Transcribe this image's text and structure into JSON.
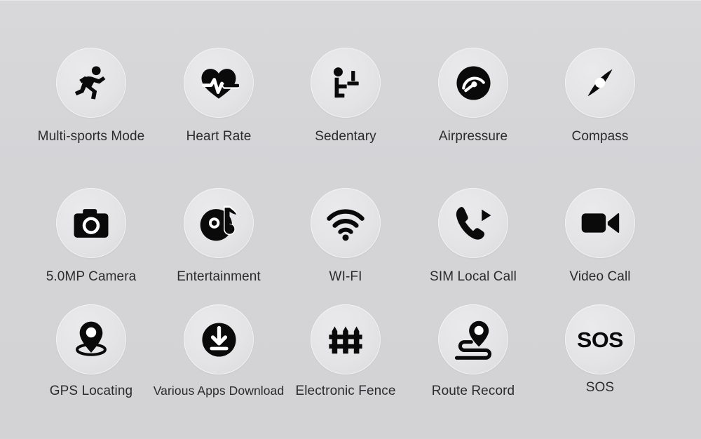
{
  "page": {
    "background_color": "#d4d4d7",
    "badge_color": "#e4e4e6",
    "icon_color": "#0a0a0a",
    "label_color": "#2b2b2d",
    "columns": 5,
    "rows": 3
  },
  "features": [
    {
      "id": "multi-sports-mode",
      "label": "Multi-sports Mode",
      "icon": "running-person-icon",
      "row": 1,
      "col": 1
    },
    {
      "id": "heart-rate",
      "label": "Heart Rate",
      "icon": "heart-pulse-icon",
      "row": 1,
      "col": 2
    },
    {
      "id": "sedentary",
      "label": "Sedentary",
      "icon": "sitting-person-desk-icon",
      "row": 1,
      "col": 3
    },
    {
      "id": "airpressure",
      "label": "Airpressure",
      "icon": "barometer-gauge-icon",
      "row": 1,
      "col": 4
    },
    {
      "id": "compass",
      "label": "Compass",
      "icon": "compass-needle-icon",
      "row": 1,
      "col": 5
    },
    {
      "id": "camera",
      "label": "5.0MP Camera",
      "icon": "camera-icon",
      "row": 2,
      "col": 1
    },
    {
      "id": "entertainment",
      "label": "Entertainment",
      "icon": "disc-music-note-icon",
      "row": 2,
      "col": 2
    },
    {
      "id": "wifi",
      "label": "WI-FI",
      "icon": "wifi-icon",
      "row": 2,
      "col": 3
    },
    {
      "id": "sim-local-call",
      "label": "SIM Local Call",
      "icon": "phone-call-icon",
      "row": 2,
      "col": 4
    },
    {
      "id": "video-call",
      "label": "Video Call",
      "icon": "video-camera-icon",
      "row": 2,
      "col": 5
    },
    {
      "id": "gps-locating",
      "label": "GPS Locating",
      "icon": "map-pin-locate-icon",
      "row": 3,
      "col": 1
    },
    {
      "id": "apps-download",
      "label": "Various Apps Download",
      "icon": "download-circle-icon",
      "row": 3,
      "col": 2
    },
    {
      "id": "electronic-fence",
      "label": "Electronic Fence",
      "icon": "fence-icon",
      "row": 3,
      "col": 3
    },
    {
      "id": "route-record",
      "label": "Route Record",
      "icon": "route-pin-path-icon",
      "row": 3,
      "col": 4
    },
    {
      "id": "sos",
      "label": "SOS",
      "icon": "sos-text-icon",
      "row": 3,
      "col": 5,
      "badge_text": "SOS"
    }
  ]
}
